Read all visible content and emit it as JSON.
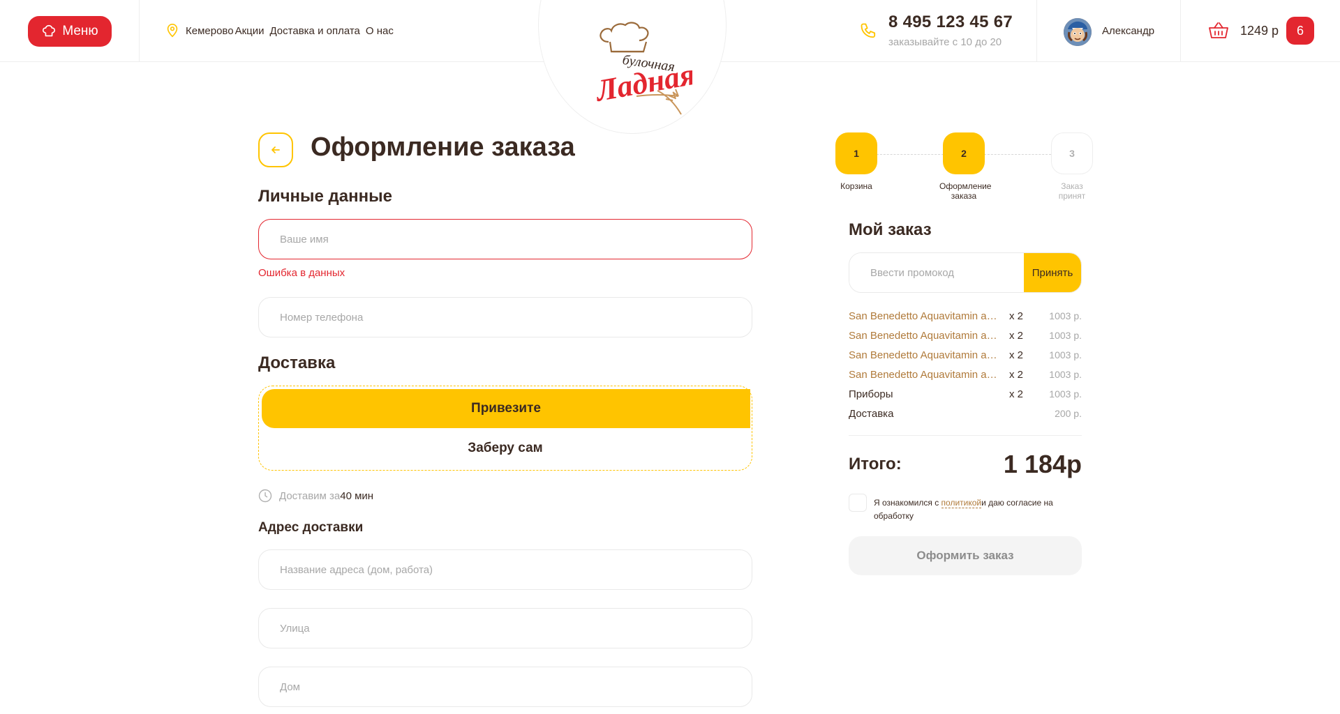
{
  "header": {
    "menu_label": "Меню",
    "city": "Кемерово",
    "nav": [
      "Акции",
      "Доставка и оплата",
      "О нас"
    ],
    "phone": "8 495 123 45 67",
    "phone_hours": "заказывайте с 10 до 20",
    "user_name": "Александр",
    "cart_sum": "1249 р",
    "cart_count": "6"
  },
  "logo": {
    "line1": "булочная",
    "line2": "Ладная"
  },
  "form": {
    "title": "Оформление заказа",
    "personal_title": "Личные данные",
    "name_placeholder": "Ваше имя",
    "name_error": "Ошибка в данных",
    "phone_placeholder": "Номер телефона",
    "delivery_title": "Доставка",
    "delivery_option": "Привезите",
    "pickup_option": "Заберу сам",
    "eta_label": "Доставим за",
    "eta_value": "40 мин",
    "address_title": "Адрес доставки",
    "address_name_placeholder": "Название адреса (дом, работа)",
    "street_placeholder": "Улица",
    "house_placeholder": "Дом"
  },
  "steps": [
    {
      "num": "1",
      "label": "Корзина",
      "state": "done"
    },
    {
      "num": "2",
      "label": "Оформление заказа",
      "state": "done"
    },
    {
      "num": "3",
      "label": "Заказ принят",
      "state": "todo"
    }
  ],
  "order": {
    "title": "Мой заказ",
    "promo_placeholder": "Ввести промокод",
    "promo_button": "Принять",
    "items": [
      {
        "name": "San Benedetto Aquavitamin antiox",
        "qty": "х 2",
        "price": "1003 р.",
        "kind": "prod"
      },
      {
        "name": "San Benedetto Aquavitamin antiox",
        "qty": "х 2",
        "price": "1003 р.",
        "kind": "prod"
      },
      {
        "name": "San Benedetto Aquavitamin antiox",
        "qty": "х 2",
        "price": "1003 р.",
        "kind": "prod"
      },
      {
        "name": "San Benedetto Aquavitamin antiox",
        "qty": "х 2",
        "price": "1003 р.",
        "kind": "prod"
      },
      {
        "name": "Приборы",
        "qty": "х 2",
        "price": "1003 р.",
        "kind": "plain"
      },
      {
        "name": "Доставка",
        "qty": "",
        "price": "200 р.",
        "kind": "plain"
      }
    ],
    "total_label": "Итого:",
    "total_value": "1 184р",
    "agree_before": "Я ознакомился с ",
    "agree_link": "политикой",
    "agree_after": "и даю согласие на обработку",
    "submit_label": "Оформить заказ"
  },
  "colors": {
    "accent_red": "#e3262f",
    "accent_yellow": "#ffc400",
    "text_dark": "#3b2a22",
    "product_link": "#b07a3a"
  },
  "icons": [
    "chef-hat-icon",
    "location-pin-icon",
    "phone-icon",
    "cart-icon",
    "arrow-left-icon",
    "clock-icon"
  ]
}
